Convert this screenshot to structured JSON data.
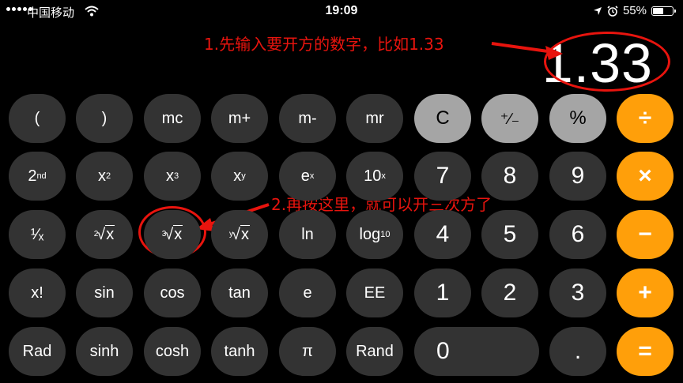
{
  "status_bar": {
    "carrier": "中国移动",
    "time": "19:09",
    "battery_percent": "55%",
    "battery_level": 0.55
  },
  "display": {
    "value": "1.33"
  },
  "annotations": {
    "step1": "1.先输入要开方的数字，比如1.33",
    "step2": "2.再按这里，就可以开三次方了"
  },
  "keys": {
    "open_paren": "(",
    "close_paren": ")",
    "mc": "mc",
    "m_plus": "m+",
    "m_minus": "m-",
    "mr": "mr",
    "clear": "C",
    "plus_minus": "⁺∕₋",
    "percent": "%",
    "divide": "÷",
    "second": "2",
    "second_sup": "nd",
    "x2": "x",
    "x2_sup": "2",
    "x3": "x",
    "x3_sup": "3",
    "xy": "x",
    "xy_sup": "y",
    "ex": "e",
    "ex_sup": "x",
    "tenx": "10",
    "tenx_sup": "x",
    "seven": "7",
    "eight": "8",
    "nine": "9",
    "multiply": "×",
    "reciprocal": "¹∕ₓ",
    "sqrt_idx": "2",
    "cbrt_idx": "3",
    "yroot_idx": "y",
    "root_sym": "√",
    "root_x": "x",
    "ln": "ln",
    "log10": "log",
    "log10_sub": "10",
    "four": "4",
    "five": "5",
    "six": "6",
    "minus": "−",
    "factorial": "x!",
    "sin": "sin",
    "cos": "cos",
    "tan": "tan",
    "e": "e",
    "ee": "EE",
    "one": "1",
    "two": "2",
    "three": "3",
    "plus": "+",
    "rad": "Rad",
    "sinh": "sinh",
    "cosh": "cosh",
    "tanh": "tanh",
    "pi": "π",
    "rand": "Rand",
    "zero": "0",
    "decimal": ".",
    "equals": "="
  },
  "colors": {
    "function_key": "#333333",
    "light_key": "#a5a5a5",
    "operator_key": "#ff9f0a",
    "annotation": "#e8140e",
    "background": "#000000"
  }
}
